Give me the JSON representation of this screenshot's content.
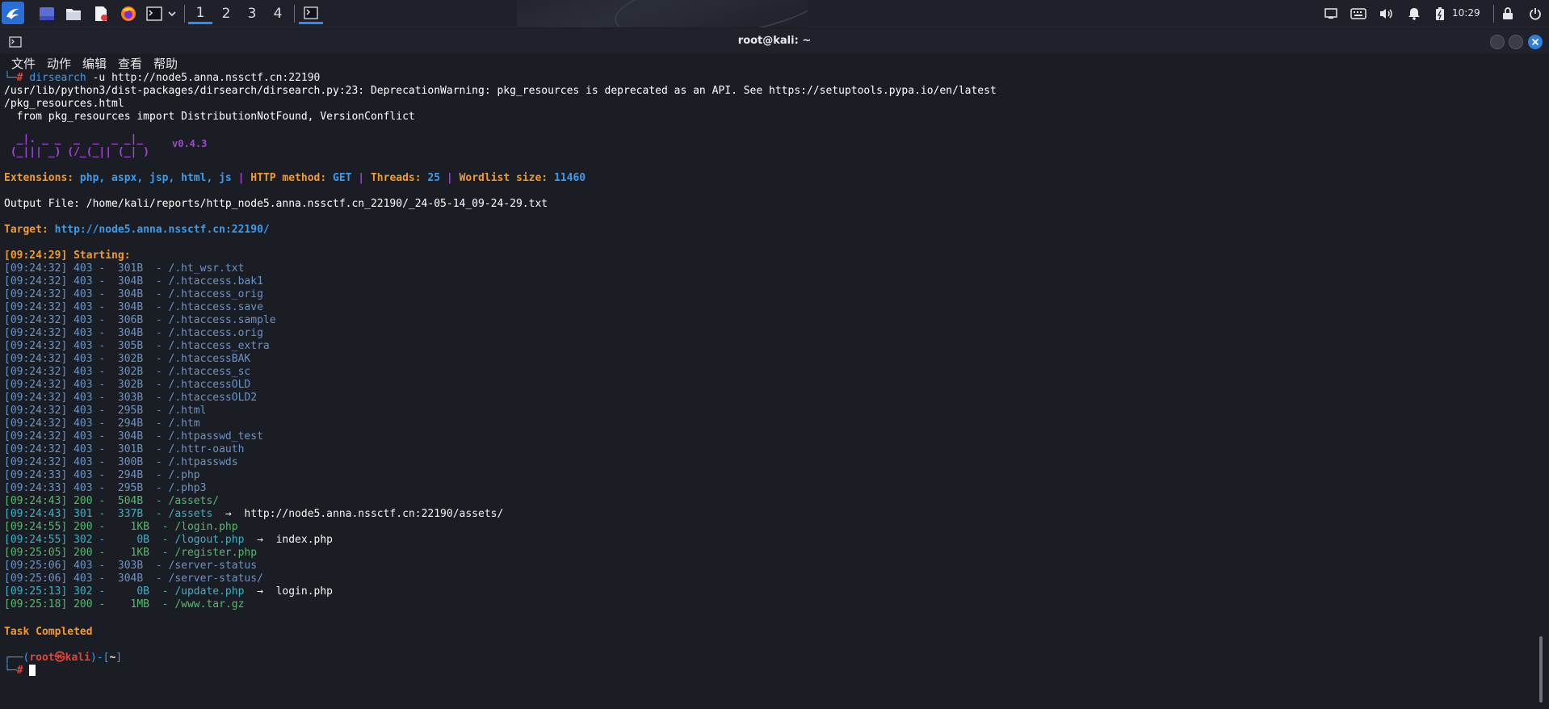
{
  "taskbar": {
    "workspaces": [
      "1",
      "2",
      "3",
      "4"
    ],
    "active_workspace": "1",
    "clock": "10:29",
    "icons": [
      "kali-menu-icon",
      "show-desktop-icon",
      "file-manager-icon",
      "text-editor-icon",
      "firefox-icon",
      "terminal-icon",
      "dropdown-chevron-icon",
      "terminal-task-icon"
    ],
    "tray_icons": [
      "monitor-icon",
      "keyboard-icon",
      "volume-icon",
      "notification-bell-icon",
      "battery-icon",
      "lock-icon",
      "power-icon"
    ]
  },
  "window": {
    "title": "root@kali: ~",
    "menu": [
      "文件",
      "动作",
      "编辑",
      "查看",
      "帮助"
    ]
  },
  "terminal": {
    "command": "dirsearch -u http://node5.anna.nssctf.cn:22190",
    "warning_line1": "/usr/lib/python3/dist-packages/dirsearch/dirsearch.py:23: DeprecationWarning: pkg_resources is deprecated as an API. See https://setuptools.pypa.io/en/latest",
    "warning_line2": "/pkg_resources.html",
    "warning_line3": "  from pkg_resources import DistributionNotFound, VersionConflict",
    "banner_line1": "  _|. _ _  _  _  _ _|_",
    "banner_line2": " (_||| _) (/_(_|| (_| )",
    "version": "v0.4.3",
    "config": {
      "ext_label": "Extensions: ",
      "ext_value": "php, aspx, jsp, html, js",
      "method_label": "HTTP method: ",
      "method_value": "GET",
      "threads_label": "Threads: ",
      "threads_value": "25",
      "wordlist_label": "Wordlist size: ",
      "wordlist_value": "11460",
      "sep": " | "
    },
    "output_file": "Output File: /home/kali/reports/http_node5.anna.nssctf.cn_22190/_24-05-14_09-24-29.txt",
    "target_label": "Target: ",
    "target_url": "http://node5.anna.nssctf.cn:22190/",
    "starting": "[09:24:29] Starting: ",
    "results": [
      {
        "time": "[09:24:32]",
        "code": "403",
        "size": " 301B",
        "path": "/.ht_wsr.txt",
        "redirect": ""
      },
      {
        "time": "[09:24:32]",
        "code": "403",
        "size": " 304B",
        "path": "/.htaccess.bak1",
        "redirect": ""
      },
      {
        "time": "[09:24:32]",
        "code": "403",
        "size": " 304B",
        "path": "/.htaccess_orig",
        "redirect": ""
      },
      {
        "time": "[09:24:32]",
        "code": "403",
        "size": " 304B",
        "path": "/.htaccess.save",
        "redirect": ""
      },
      {
        "time": "[09:24:32]",
        "code": "403",
        "size": " 306B",
        "path": "/.htaccess.sample",
        "redirect": ""
      },
      {
        "time": "[09:24:32]",
        "code": "403",
        "size": " 304B",
        "path": "/.htaccess.orig",
        "redirect": ""
      },
      {
        "time": "[09:24:32]",
        "code": "403",
        "size": " 305B",
        "path": "/.htaccess_extra",
        "redirect": ""
      },
      {
        "time": "[09:24:32]",
        "code": "403",
        "size": " 302B",
        "path": "/.htaccessBAK",
        "redirect": ""
      },
      {
        "time": "[09:24:32]",
        "code": "403",
        "size": " 302B",
        "path": "/.htaccess_sc",
        "redirect": ""
      },
      {
        "time": "[09:24:32]",
        "code": "403",
        "size": " 302B",
        "path": "/.htaccessOLD",
        "redirect": ""
      },
      {
        "time": "[09:24:32]",
        "code": "403",
        "size": " 303B",
        "path": "/.htaccessOLD2",
        "redirect": ""
      },
      {
        "time": "[09:24:32]",
        "code": "403",
        "size": " 295B",
        "path": "/.html",
        "redirect": ""
      },
      {
        "time": "[09:24:32]",
        "code": "403",
        "size": " 294B",
        "path": "/.htm",
        "redirect": ""
      },
      {
        "time": "[09:24:32]",
        "code": "403",
        "size": " 304B",
        "path": "/.htpasswd_test",
        "redirect": ""
      },
      {
        "time": "[09:24:32]",
        "code": "403",
        "size": " 301B",
        "path": "/.httr-oauth",
        "redirect": ""
      },
      {
        "time": "[09:24:32]",
        "code": "403",
        "size": " 300B",
        "path": "/.htpasswds",
        "redirect": ""
      },
      {
        "time": "[09:24:33]",
        "code": "403",
        "size": " 294B",
        "path": "/.php",
        "redirect": ""
      },
      {
        "time": "[09:24:33]",
        "code": "403",
        "size": " 295B",
        "path": "/.php3",
        "redirect": ""
      },
      {
        "time": "[09:24:43]",
        "code": "200",
        "size": " 504B",
        "path": "/assets/",
        "redirect": ""
      },
      {
        "time": "[09:24:43]",
        "code": "301",
        "size": " 337B",
        "path": "/assets",
        "redirect": "http://node5.anna.nssctf.cn:22190/assets/"
      },
      {
        "time": "[09:24:55]",
        "code": "200",
        "size": "   1KB",
        "path": "/login.php",
        "redirect": ""
      },
      {
        "time": "[09:24:55]",
        "code": "302",
        "size": "    0B",
        "path": "/logout.php",
        "redirect": "index.php"
      },
      {
        "time": "[09:25:05]",
        "code": "200",
        "size": "   1KB",
        "path": "/register.php",
        "redirect": ""
      },
      {
        "time": "[09:25:06]",
        "code": "403",
        "size": " 303B",
        "path": "/server-status",
        "redirect": ""
      },
      {
        "time": "[09:25:06]",
        "code": "403",
        "size": " 304B",
        "path": "/server-status/",
        "redirect": ""
      },
      {
        "time": "[09:25:13]",
        "code": "302",
        "size": "    0B",
        "path": "/update.php",
        "redirect": "login.php"
      },
      {
        "time": "[09:25:18]",
        "code": "200",
        "size": "   1MB",
        "path": "/www.tar.gz",
        "redirect": ""
      }
    ],
    "arrow": "  →  ",
    "completed": "Task Completed",
    "prompt_user": "root",
    "prompt_at": "㉿",
    "prompt_host": "kali",
    "prompt_dir": "~",
    "prompt_symbol": "#"
  },
  "colors": {
    "status_403": "#6b93c8",
    "status_200": "#58b872",
    "status_301": "#3db1c4",
    "status_302": "#3db1c4",
    "accent_orange": "#f39a2c",
    "banner_purple": "#a545d8",
    "prompt_red": "#e2453a"
  }
}
